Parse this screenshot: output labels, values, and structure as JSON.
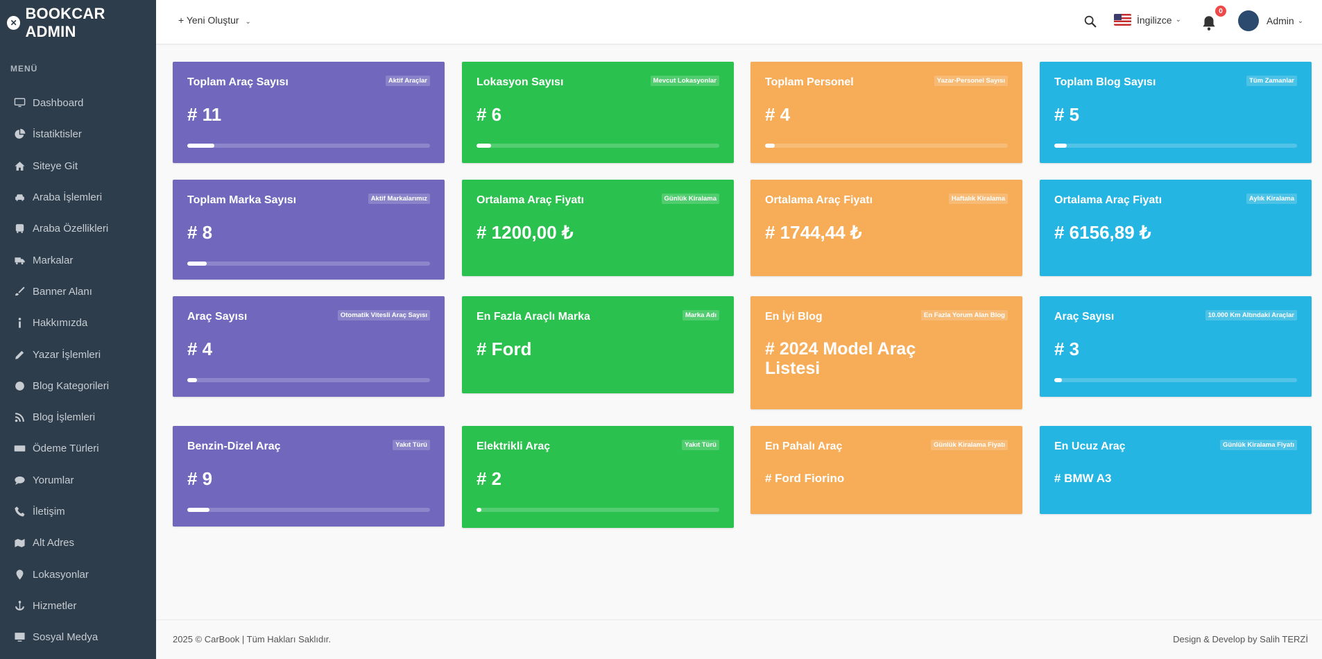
{
  "brand": {
    "title": "BOOKCAR ADMIN"
  },
  "sidebar": {
    "menu_title": "MENÜ",
    "items": [
      {
        "label": "Dashboard",
        "icon": "monitor-icon"
      },
      {
        "label": "İstatiktisler",
        "icon": "pie-chart-icon"
      },
      {
        "label": "Siteye Git",
        "icon": "home-icon"
      },
      {
        "label": "Araba İşlemleri",
        "icon": "car-icon"
      },
      {
        "label": "Araba Özellikleri",
        "icon": "bus-icon"
      },
      {
        "label": "Markalar",
        "icon": "truck-icon"
      },
      {
        "label": "Banner Alanı",
        "icon": "brush-icon"
      },
      {
        "label": "Hakkımızda",
        "icon": "info-icon"
      },
      {
        "label": "Yazar İşlemleri",
        "icon": "pencil-icon"
      },
      {
        "label": "Blog Kategorileri",
        "icon": "gear-icon"
      },
      {
        "label": "Blog İşlemleri",
        "icon": "feed-icon"
      },
      {
        "label": "Ödeme Türleri",
        "icon": "money-icon"
      },
      {
        "label": "Yorumlar",
        "icon": "comment-icon"
      },
      {
        "label": "İletişim",
        "icon": "phone-icon"
      },
      {
        "label": "Alt Adres",
        "icon": "map-icon"
      },
      {
        "label": "Lokasyonlar",
        "icon": "pin-icon"
      },
      {
        "label": "Hizmetler",
        "icon": "anchor-icon"
      },
      {
        "label": "Sosyal Medya",
        "icon": "desktop-icon"
      }
    ]
  },
  "header": {
    "create_label": "Yeni Oluştur",
    "language": "İngilizce",
    "notification_count": "0",
    "user_name": "Admin"
  },
  "cards": [
    {
      "title": "Toplam Araç Sayısı",
      "tag": "Aktif Araçlar",
      "value": "# 11",
      "progress": 0.11,
      "color": "#7168bd"
    },
    {
      "title": "Lokasyon Sayısı",
      "tag": "Mevcut Lokasyonlar",
      "value": "# 6",
      "progress": 0.06,
      "color": "#2bc14f"
    },
    {
      "title": "Toplam Personel",
      "tag": "Yazar-Personel Sayısı",
      "value": "# 4",
      "progress": 0.04,
      "color": "#f7ac58"
    },
    {
      "title": "Toplam Blog Sayısı",
      "tag": "Tüm Zamanlar",
      "value": "# 5",
      "progress": 0.05,
      "color": "#25b5e2"
    },
    {
      "title": "Toplam Marka Sayısı",
      "tag": "Aktif Markalarımız",
      "value": "# 8",
      "progress": 0.08,
      "color": "#7168bd"
    },
    {
      "title": "Ortalama Araç Fiyatı",
      "tag": "Günlük Kiralama",
      "value": "# 1200,00 ₺",
      "color": "#2bc14f"
    },
    {
      "title": "Ortalama Araç Fiyatı",
      "tag": "Haftalık Kiralama",
      "value": "# 1744,44 ₺",
      "color": "#f7ac58"
    },
    {
      "title": "Ortalama Araç Fiyatı",
      "tag": "Aylık Kiralama",
      "value": "# 6156,89 ₺",
      "color": "#25b5e2"
    },
    {
      "title": "Araç Sayısı",
      "tag": "Otomatik Vitesli Araç Sayısı",
      "value": "# 4",
      "progress": 0.04,
      "color": "#7168bd"
    },
    {
      "title": "En Fazla Araçlı Marka",
      "tag": "Marka Adı",
      "value": "# Ford",
      "color": "#2bc14f"
    },
    {
      "title": "En İyi Blog",
      "tag": "En Fazla Yorum Alan Blog",
      "value": "# 2024 Model Araç Listesi",
      "color": "#f7ac58"
    },
    {
      "title": "Araç Sayısı",
      "tag": "10.000 Km Altındaki Araçlar",
      "value": "# 3",
      "progress": 0.03,
      "color": "#25b5e2"
    },
    {
      "title": "Benzin-Dizel Araç",
      "tag": "Yakıt Türü",
      "value": "# 9",
      "progress": 0.09,
      "color": "#7168bd"
    },
    {
      "title": "Elektrikli Araç",
      "tag": "Yakıt Türü",
      "value": "# 2",
      "progress": 0.02,
      "color": "#2bc14f"
    },
    {
      "title": "En Pahalı Araç",
      "tag": "Günlük Kiralama Fiyatı",
      "value": "# Ford Fiorino",
      "color": "#f7ac58"
    },
    {
      "title": "En Ucuz Araç",
      "tag": "Günlük Kiralama Fiyatı",
      "value": "# BMW A3",
      "color": "#25b5e2"
    }
  ],
  "footer": {
    "copyright": "2025 © CarBook | Tüm Hakları Saklıdır.",
    "credit": "Design & Develop by Salih TERZİ"
  }
}
